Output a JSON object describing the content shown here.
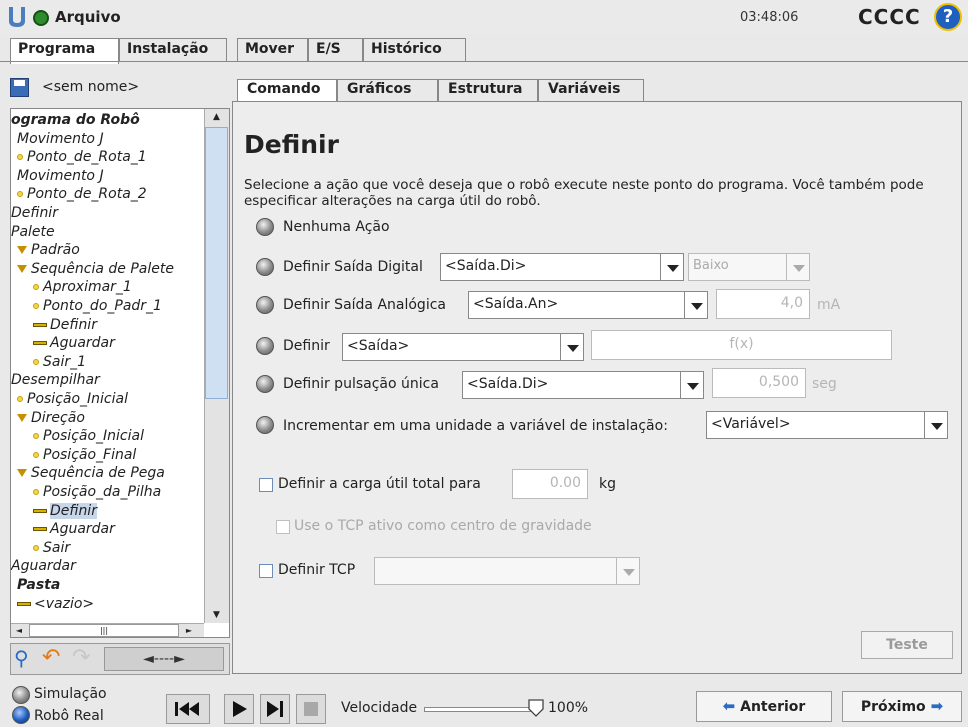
{
  "titlebar": {
    "app_title": "Arquivo",
    "clock": "03:48:06",
    "robot_name": "CCCC",
    "help_glyph": "?"
  },
  "main_tabs": [
    "Programa",
    "Instalação",
    "Mover",
    "E/S",
    "Histórico"
  ],
  "sub_tabs": [
    "Comando",
    "Gráficos",
    "Estrutura",
    "Variáveis"
  ],
  "program": {
    "file_name": "<sem nome>"
  },
  "tree": [
    {
      "label": "ograma do Robô",
      "bold": true
    },
    {
      "label": "Movimento J"
    },
    {
      "label": "Ponto_de_Rota_1",
      "icon": "waypoint-icon"
    },
    {
      "label": "Movimento J"
    },
    {
      "label": "Ponto_de_Rota_2",
      "icon": "waypoint-icon"
    },
    {
      "label": "Definir"
    },
    {
      "label": "Palete"
    },
    {
      "label": "Padrão",
      "icon": "expand-icon"
    },
    {
      "label": "Sequência de Palete",
      "icon": "expand-icon"
    },
    {
      "label": "Aproximar_1",
      "icon": "waypoint-icon"
    },
    {
      "label": "Ponto_do_Padr_1",
      "icon": "waypoint-icon"
    },
    {
      "label": "Definir",
      "icon": "command-icon"
    },
    {
      "label": "Aguardar",
      "icon": "command-icon"
    },
    {
      "label": "Sair_1",
      "icon": "waypoint-icon"
    },
    {
      "label": "Desempilhar"
    },
    {
      "label": "Posição_Inicial",
      "icon": "waypoint-icon"
    },
    {
      "label": "Direção",
      "icon": "expand-icon"
    },
    {
      "label": "Posição_Inicial",
      "icon": "waypoint-icon"
    },
    {
      "label": "Posição_Final",
      "icon": "waypoint-icon"
    },
    {
      "label": "Sequência de Pega",
      "icon": "expand-icon"
    },
    {
      "label": "Posição_da_Pilha",
      "icon": "waypoint-icon"
    },
    {
      "label": "Definir",
      "icon": "command-icon",
      "selected": true
    },
    {
      "label": "Aguardar",
      "icon": "command-icon"
    },
    {
      "label": "Sair",
      "icon": "waypoint-icon"
    },
    {
      "label": "Aguardar"
    },
    {
      "label": "Pasta",
      "bold": true
    },
    {
      "label": "<vazio>",
      "icon": "command-icon"
    }
  ],
  "left_toolbar": {
    "move_label": "◄----►"
  },
  "page": {
    "title": "Definir",
    "description": "Selecione a ação que você deseja que o robô execute neste ponto do programa. Você também pode especificar alterações na carga útil do robô.",
    "opt_none": "Nenhuma Ação",
    "opt_digital": "Definir Saída Digital",
    "digital_combo": "<Saída.Di>",
    "digital_value": "Baixo",
    "opt_analog": "Definir Saída Analógica",
    "analog_combo": "<Saída.An>",
    "analog_value": "4,0",
    "analog_unit": "mA",
    "opt_expr": "Definir",
    "expr_combo": "<Saída>",
    "expr_value": "f(x)",
    "opt_pulse": "Definir pulsação única",
    "pulse_combo": "<Saída.Di>",
    "pulse_value": "0,500",
    "pulse_unit": "seg",
    "opt_increment": "Incrementar em uma unidade a variável de instalação:",
    "increment_combo": "<Variável>",
    "payload_label": "Definir a carga útil total para",
    "payload_value": "0.00",
    "payload_unit": "kg",
    "tcp_cog_label": "Use o TCP ativo como centro de gravidade",
    "tcp_label": "Definir TCP",
    "tcp_combo": "",
    "test_label": "Teste"
  },
  "footer": {
    "sim_label": "Simulação",
    "real_label": "Robô Real",
    "speed_label": "Velocidade",
    "speed_value": "100%",
    "speed_fraction": 1.0,
    "prev_label": "Anterior",
    "next_label": "Próximo"
  }
}
